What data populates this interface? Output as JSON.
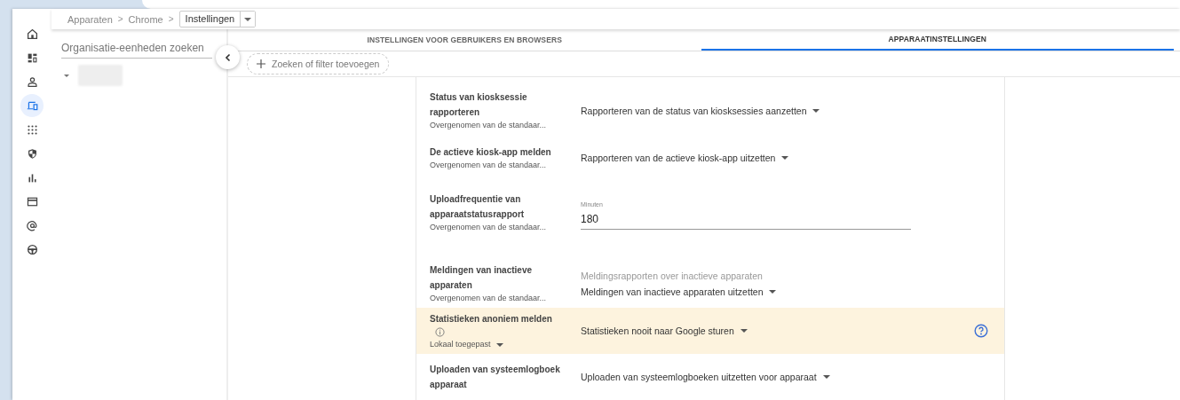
{
  "breadcrumb": {
    "items": [
      "Apparaten",
      "Chrome"
    ],
    "separator": ">",
    "current": "Instellingen"
  },
  "rail": [
    {
      "kind": "home",
      "selected": false
    },
    {
      "kind": "dashboard",
      "selected": false
    },
    {
      "kind": "person",
      "selected": false
    },
    {
      "kind": "devices",
      "selected": true
    },
    {
      "kind": "apps",
      "selected": false
    },
    {
      "kind": "shield",
      "selected": false
    },
    {
      "kind": "chart",
      "selected": false
    },
    {
      "kind": "card",
      "selected": false
    },
    {
      "kind": "at",
      "selected": false
    },
    {
      "kind": "wheel",
      "selected": false
    }
  ],
  "sidebar": {
    "search": {
      "placeholder": "Organisatie-eenheden zoeken"
    },
    "tree": [
      {
        "expanded": true
      }
    ]
  },
  "tabs": [
    {
      "label": "INSTELLINGEN VOOR GEBRUIKERS EN BROWSERS",
      "selected": false
    },
    {
      "label": "APPARAATINSTELLINGEN",
      "selected": true
    }
  ],
  "filter": {
    "label": "Zoeken of filter toevoegen"
  },
  "settings": [
    {
      "kind": "dropdown",
      "title": "Status van kiosksessie rapporteren",
      "source": "Overgenomen van de standaar...",
      "value": "Rapporteren van de status van kiosksessies aanzetten",
      "highlighted": false
    },
    {
      "kind": "dropdown",
      "title": "De actieve kiosk-app melden",
      "source": "Overgenomen van de standaar...",
      "value": "Rapporteren van de actieve kiosk-app uitzetten",
      "highlighted": false
    },
    {
      "kind": "input",
      "title": "Uploadfrequentie van apparaatstatusrapport",
      "source": "Overgenomen van de standaar...",
      "field_label": "Minuten",
      "value": "180",
      "highlighted": false
    },
    {
      "kind": "dropdown",
      "title": "Meldingen van inactieve apparaten",
      "source": "Overgenomen van de standaar...",
      "caption": "Meldingsrapporten over inactieve apparaten",
      "value": "Meldingen van inactieve apparaten uitzetten",
      "highlighted": false
    },
    {
      "kind": "dropdown",
      "title": "Statistieken anoniem melden",
      "info": true,
      "source": "Lokaal toegepast",
      "source_menu": true,
      "value": "Statistieken nooit naar Google sturen",
      "highlighted": true,
      "help": true
    },
    {
      "kind": "dropdown",
      "title": "Uploaden van systeemlogboek apparaat",
      "value": "Uploaden van systeemlogboeken uitzetten voor apparaat",
      "highlighted": false
    }
  ]
}
